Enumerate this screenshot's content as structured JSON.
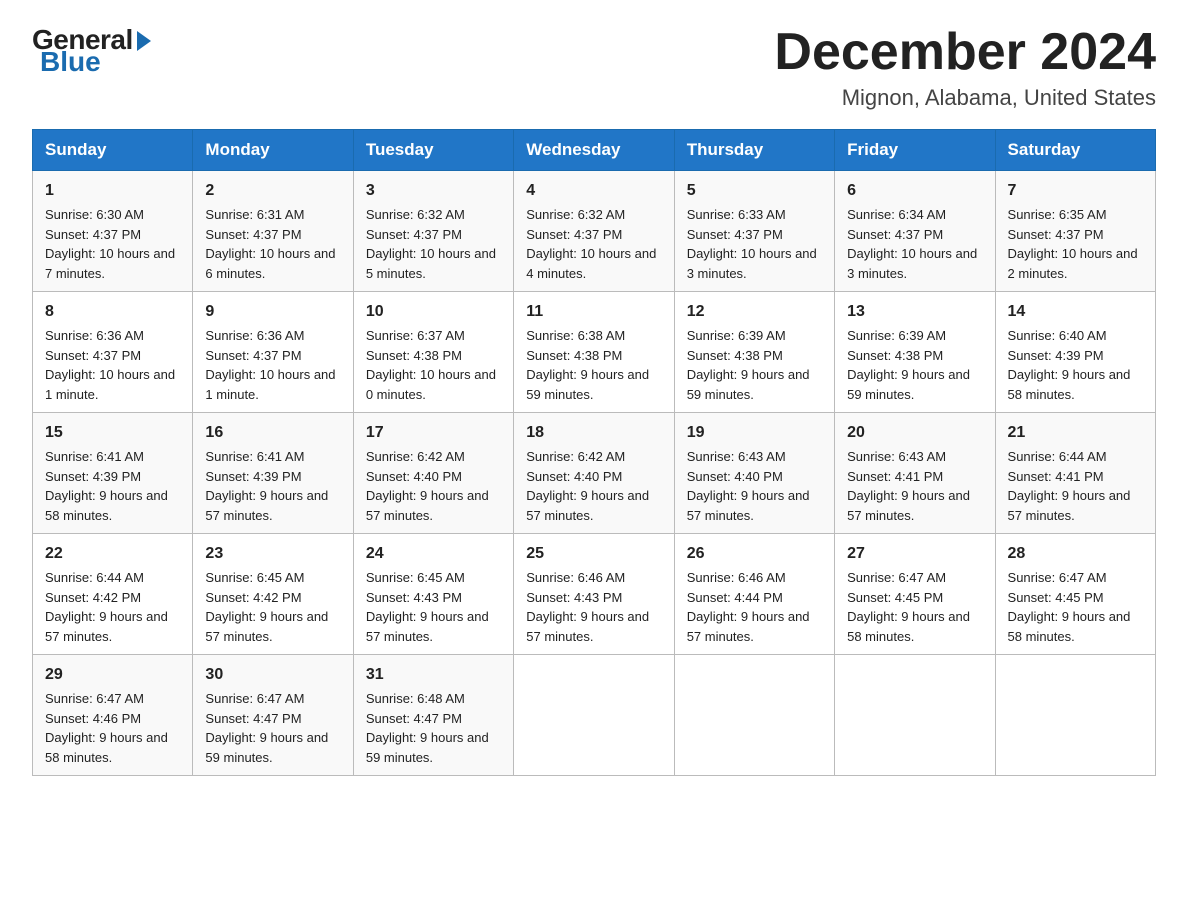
{
  "logo": {
    "general": "General",
    "blue": "Blue"
  },
  "header": {
    "month": "December 2024",
    "location": "Mignon, Alabama, United States"
  },
  "days_of_week": [
    "Sunday",
    "Monday",
    "Tuesday",
    "Wednesday",
    "Thursday",
    "Friday",
    "Saturday"
  ],
  "weeks": [
    [
      {
        "day": "1",
        "sunrise": "6:30 AM",
        "sunset": "4:37 PM",
        "daylight": "10 hours and 7 minutes."
      },
      {
        "day": "2",
        "sunrise": "6:31 AM",
        "sunset": "4:37 PM",
        "daylight": "10 hours and 6 minutes."
      },
      {
        "day": "3",
        "sunrise": "6:32 AM",
        "sunset": "4:37 PM",
        "daylight": "10 hours and 5 minutes."
      },
      {
        "day": "4",
        "sunrise": "6:32 AM",
        "sunset": "4:37 PM",
        "daylight": "10 hours and 4 minutes."
      },
      {
        "day": "5",
        "sunrise": "6:33 AM",
        "sunset": "4:37 PM",
        "daylight": "10 hours and 3 minutes."
      },
      {
        "day": "6",
        "sunrise": "6:34 AM",
        "sunset": "4:37 PM",
        "daylight": "10 hours and 3 minutes."
      },
      {
        "day": "7",
        "sunrise": "6:35 AM",
        "sunset": "4:37 PM",
        "daylight": "10 hours and 2 minutes."
      }
    ],
    [
      {
        "day": "8",
        "sunrise": "6:36 AM",
        "sunset": "4:37 PM",
        "daylight": "10 hours and 1 minute."
      },
      {
        "day": "9",
        "sunrise": "6:36 AM",
        "sunset": "4:37 PM",
        "daylight": "10 hours and 1 minute."
      },
      {
        "day": "10",
        "sunrise": "6:37 AM",
        "sunset": "4:38 PM",
        "daylight": "10 hours and 0 minutes."
      },
      {
        "day": "11",
        "sunrise": "6:38 AM",
        "sunset": "4:38 PM",
        "daylight": "9 hours and 59 minutes."
      },
      {
        "day": "12",
        "sunrise": "6:39 AM",
        "sunset": "4:38 PM",
        "daylight": "9 hours and 59 minutes."
      },
      {
        "day": "13",
        "sunrise": "6:39 AM",
        "sunset": "4:38 PM",
        "daylight": "9 hours and 59 minutes."
      },
      {
        "day": "14",
        "sunrise": "6:40 AM",
        "sunset": "4:39 PM",
        "daylight": "9 hours and 58 minutes."
      }
    ],
    [
      {
        "day": "15",
        "sunrise": "6:41 AM",
        "sunset": "4:39 PM",
        "daylight": "9 hours and 58 minutes."
      },
      {
        "day": "16",
        "sunrise": "6:41 AM",
        "sunset": "4:39 PM",
        "daylight": "9 hours and 57 minutes."
      },
      {
        "day": "17",
        "sunrise": "6:42 AM",
        "sunset": "4:40 PM",
        "daylight": "9 hours and 57 minutes."
      },
      {
        "day": "18",
        "sunrise": "6:42 AM",
        "sunset": "4:40 PM",
        "daylight": "9 hours and 57 minutes."
      },
      {
        "day": "19",
        "sunrise": "6:43 AM",
        "sunset": "4:40 PM",
        "daylight": "9 hours and 57 minutes."
      },
      {
        "day": "20",
        "sunrise": "6:43 AM",
        "sunset": "4:41 PM",
        "daylight": "9 hours and 57 minutes."
      },
      {
        "day": "21",
        "sunrise": "6:44 AM",
        "sunset": "4:41 PM",
        "daylight": "9 hours and 57 minutes."
      }
    ],
    [
      {
        "day": "22",
        "sunrise": "6:44 AM",
        "sunset": "4:42 PM",
        "daylight": "9 hours and 57 minutes."
      },
      {
        "day": "23",
        "sunrise": "6:45 AM",
        "sunset": "4:42 PM",
        "daylight": "9 hours and 57 minutes."
      },
      {
        "day": "24",
        "sunrise": "6:45 AM",
        "sunset": "4:43 PM",
        "daylight": "9 hours and 57 minutes."
      },
      {
        "day": "25",
        "sunrise": "6:46 AM",
        "sunset": "4:43 PM",
        "daylight": "9 hours and 57 minutes."
      },
      {
        "day": "26",
        "sunrise": "6:46 AM",
        "sunset": "4:44 PM",
        "daylight": "9 hours and 57 minutes."
      },
      {
        "day": "27",
        "sunrise": "6:47 AM",
        "sunset": "4:45 PM",
        "daylight": "9 hours and 58 minutes."
      },
      {
        "day": "28",
        "sunrise": "6:47 AM",
        "sunset": "4:45 PM",
        "daylight": "9 hours and 58 minutes."
      }
    ],
    [
      {
        "day": "29",
        "sunrise": "6:47 AM",
        "sunset": "4:46 PM",
        "daylight": "9 hours and 58 minutes."
      },
      {
        "day": "30",
        "sunrise": "6:47 AM",
        "sunset": "4:47 PM",
        "daylight": "9 hours and 59 minutes."
      },
      {
        "day": "31",
        "sunrise": "6:48 AM",
        "sunset": "4:47 PM",
        "daylight": "9 hours and 59 minutes."
      },
      null,
      null,
      null,
      null
    ]
  ]
}
